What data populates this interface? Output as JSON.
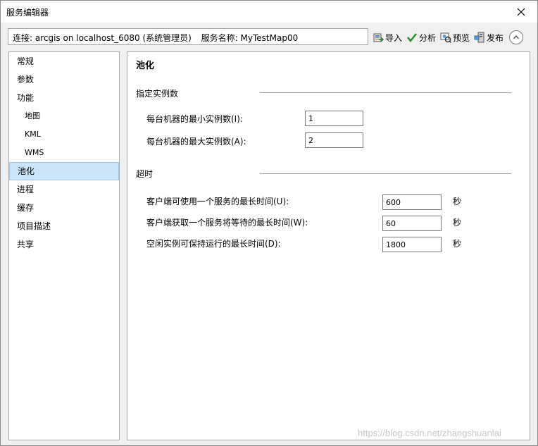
{
  "window": {
    "title": "服务编辑器"
  },
  "connection": {
    "label": "连接: arcgis on localhost_6080 (系统管理员)",
    "service": "服务名称: MyTestMap00"
  },
  "toolbar": {
    "import": "导入",
    "analyze": "分析",
    "preview": "预览",
    "publish": "发布"
  },
  "nav": {
    "items": [
      {
        "label": "常规"
      },
      {
        "label": "参数"
      },
      {
        "label": "功能"
      },
      {
        "label": "地图"
      },
      {
        "label": "KML"
      },
      {
        "label": "WMS"
      },
      {
        "label": "池化"
      },
      {
        "label": "进程"
      },
      {
        "label": "缓存"
      },
      {
        "label": "项目描述"
      },
      {
        "label": "共享"
      }
    ],
    "selected": "池化"
  },
  "pooling": {
    "title": "池化",
    "instances_section": "指定实例数",
    "min_label": "每台机器的最小实例数(I):",
    "min_value": "1",
    "max_label": "每台机器的最大实例数(A):",
    "max_value": "2",
    "timeout_section": "超时",
    "use_label": "客户端可使用一个服务的最长时间(U):",
    "use_value": "600",
    "wait_label": "客户端获取一个服务将等待的最长时间(W):",
    "wait_value": "60",
    "idle_label": "空闲实例可保持运行的最长时间(D):",
    "idle_value": "1800",
    "unit": "秒"
  },
  "watermark": "https://blog.csdn.net/zhangshuanlai"
}
